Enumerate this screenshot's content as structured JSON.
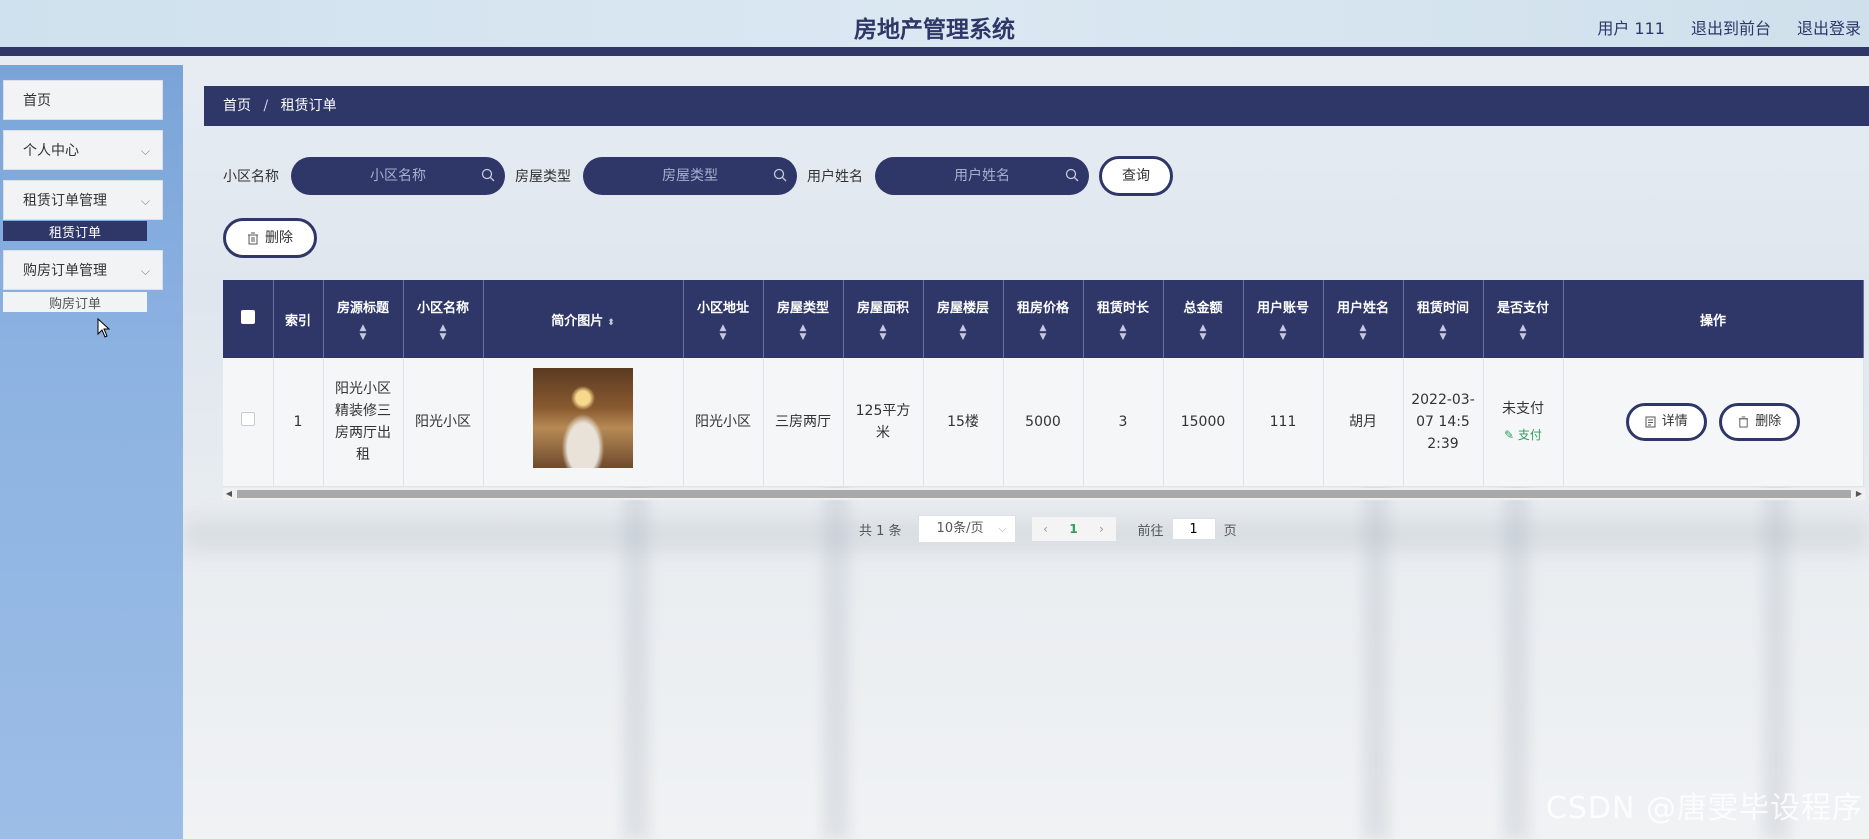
{
  "header": {
    "title": "房地产管理系统",
    "user": "用户 111",
    "exit_front": "退出到前台",
    "logout": "退出登录"
  },
  "sidebar": {
    "home": "首页",
    "personal": "个人中心",
    "rent_orders": "租赁订单管理",
    "rent_orders_sub": "租赁订单",
    "buy_orders": "购房订单管理",
    "buy_orders_sub": "购房订单"
  },
  "breadcrumb": {
    "home": "首页",
    "separator": "/",
    "current": "租赁订单"
  },
  "filters": {
    "community_label": "小区名称",
    "community_placeholder": "小区名称",
    "house_type_label": "房屋类型",
    "house_type_placeholder": "房屋类型",
    "username_label": "用户姓名",
    "username_placeholder": "用户姓名",
    "query": "查询"
  },
  "toolbar": {
    "delete": "删除"
  },
  "table": {
    "headers": [
      "索引",
      "房源标题",
      "小区名称",
      "简介图片",
      "小区地址",
      "房屋类型",
      "房屋面积",
      "房屋楼层",
      "租房价格",
      "租赁时长",
      "总金额",
      "用户账号",
      "用户姓名",
      "租赁时间",
      "是否支付",
      "操作"
    ],
    "rows": [
      {
        "index": "1",
        "title": "阳光小区精装修三房两厅出租",
        "community": "阳光小区",
        "address": "阳光小区",
        "house_type": "三房两厅",
        "area": "125平方米",
        "floor": "15楼",
        "price": "5000",
        "duration": "3",
        "total": "15000",
        "account": "111",
        "username": "胡月",
        "rent_time": "2022-03-07 14:52:39",
        "paid": "未支付",
        "pay_action": "支付",
        "detail_btn": "详情",
        "delete_btn": "删除"
      }
    ]
  },
  "pagination": {
    "total": "共 1 条",
    "page_size": "10条/页",
    "current_page": "1",
    "goto_label": "前往",
    "goto_value": "1",
    "page_unit": "页"
  },
  "watermark": "CSDN @唐雯毕设程序",
  "colors": {
    "primary": "#2e3768",
    "sidebar": "#8db3e2",
    "success": "#2e9d5e"
  }
}
